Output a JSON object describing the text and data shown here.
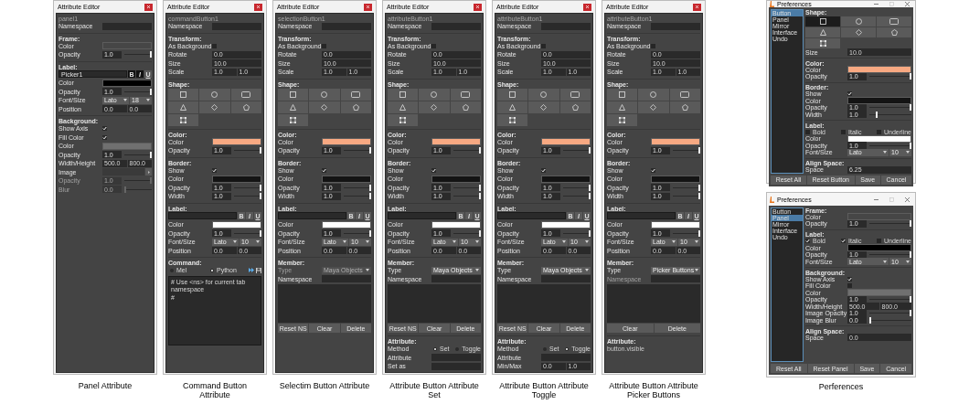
{
  "editors": [
    {
      "title": "Attribute Editor",
      "object": "panel1",
      "caption": "Panel Attribute",
      "sections": [
        {
          "rows": [
            {
              "kind": "field",
              "label": "Namespace"
            }
          ]
        },
        {
          "header": "Frame:",
          "rows": [
            {
              "kind": "color",
              "label": "Color",
              "color": "#464646"
            },
            {
              "kind": "slider",
              "label": "Opacity",
              "value": "1.0",
              "level": 1
            }
          ]
        },
        {
          "header": "Label:",
          "rows": [
            {
              "kind": "label_input",
              "value": "Picker1",
              "buttons": [
                {
                  "label": "B",
                  "selected": true
                },
                {
                  "label": "I",
                  "selected": true
                },
                {
                  "label": "U",
                  "selected": false
                }
              ]
            },
            {
              "kind": "color",
              "label": "Color",
              "color": "#000000"
            },
            {
              "kind": "slider",
              "label": "Opacity",
              "value": "1.0",
              "level": 1
            },
            {
              "kind": "font",
              "label": "Font/Size",
              "font": "Lato",
              "size": "18"
            },
            {
              "kind": "field",
              "label": "Position",
              "values": [
                "0.0",
                "0.0"
              ]
            }
          ]
        },
        {
          "header": "Background:",
          "rows": [
            {
              "kind": "check",
              "label": "Show Axis",
              "checked": true
            },
            {
              "kind": "check",
              "label": "Fill Color",
              "checked": true
            },
            {
              "kind": "color",
              "label": "Color",
              "color": "#707070"
            },
            {
              "kind": "slider",
              "label": "Opacity",
              "value": "1.0",
              "level": 1,
              "disabled": false
            },
            {
              "kind": "field",
              "label": "Width/Height",
              "values": [
                "500.0",
                "800.0"
              ]
            },
            {
              "kind": "image",
              "label": "Image"
            },
            {
              "kind": "slider",
              "label": "Opacity",
              "value": "1.0",
              "level": 1,
              "disabled": true
            },
            {
              "kind": "slider",
              "label": "Blur",
              "value": "0.0",
              "level": 0,
              "disabled": true
            }
          ]
        }
      ]
    },
    {
      "title": "Attribute Editor",
      "object": "commandButton1",
      "caption": "Command Button Attribute",
      "sections": [
        {
          "rows": [
            {
              "kind": "field",
              "label": "Namespace"
            }
          ]
        },
        {
          "header": "Transform:",
          "rows": [
            {
              "kind": "check",
              "label": "As Background",
              "checked": false
            },
            {
              "kind": "field",
              "label": "Rotate",
              "values": [
                "0.0"
              ]
            },
            {
              "kind": "field",
              "label": "Size",
              "values": [
                "10.0"
              ]
            },
            {
              "kind": "field",
              "label": "Scale",
              "values": [
                "1.0",
                "1.0"
              ]
            }
          ]
        },
        {
          "header": "Shape:",
          "rows": [
            {
              "kind": "shapes",
              "shapes": [
                {
                  "kind": "square",
                  "selected": false
                },
                {
                  "kind": "circle",
                  "selected": false
                },
                {
                  "kind": "rounded_rectangle",
                  "selected": false
                },
                {
                  "kind": "triangle",
                  "selected": false
                },
                {
                  "kind": "diamond",
                  "selected": false
                },
                {
                  "kind": "pentagon",
                  "selected": false
                },
                {
                  "kind": "frame",
                  "selected": false
                }
              ]
            }
          ]
        },
        {
          "header": "Color:",
          "rows": [
            {
              "kind": "color",
              "label": "Color",
              "color": "#f8a982"
            },
            {
              "kind": "slider",
              "label": "Opacity",
              "value": "1.0",
              "level": 1
            }
          ]
        },
        {
          "header": "Border:",
          "rows": [
            {
              "kind": "check",
              "label": "Show",
              "checked": true
            },
            {
              "kind": "color",
              "label": "Color",
              "color": "#141414"
            },
            {
              "kind": "slider",
              "label": "Opacity",
              "value": "1.0",
              "level": 1
            },
            {
              "kind": "slider",
              "label": "Width",
              "value": "1.0",
              "level": 1
            }
          ]
        },
        {
          "header": "Label:",
          "rows": [
            {
              "kind": "label_input",
              "buttons": [
                {
                  "label": "B",
                  "selected": false
                },
                {
                  "label": "I",
                  "selected": false
                },
                {
                  "label": "U",
                  "selected": false
                }
              ]
            },
            {
              "kind": "color",
              "label": "Color",
              "color": "#ffffff"
            },
            {
              "kind": "slider",
              "label": "Opacity",
              "value": "1.0",
              "level": 1
            },
            {
              "kind": "font",
              "label": "Font/Size",
              "font": "Lato",
              "size": "10"
            },
            {
              "kind": "field",
              "label": "Position",
              "values": [
                "0.0",
                "0.0"
              ]
            }
          ]
        },
        {
          "header": "Command:",
          "rows": [
            {
              "kind": "lang",
              "options": [
                {
                  "label": "Mel",
                  "selected": false
                },
                {
                  "label": "Python",
                  "selected": true
                }
              ]
            },
            {
              "kind": "textarea",
              "lines": [
                "# Use <ns> for current tab namespace",
                "#"
              ]
            }
          ]
        }
      ]
    },
    {
      "title": "Attribute Editor",
      "object": "selectionButton1",
      "caption": "Selectim Button Attribute",
      "sections": [
        {
          "rows": [
            {
              "kind": "field",
              "label": "Namespace"
            }
          ]
        },
        {
          "header": "Transform:",
          "rows": [
            {
              "kind": "check",
              "label": "As Background",
              "checked": false
            },
            {
              "kind": "field",
              "label": "Rotate",
              "values": [
                "0.0"
              ]
            },
            {
              "kind": "field",
              "label": "Size",
              "values": [
                "10.0"
              ]
            },
            {
              "kind": "field",
              "label": "Scale",
              "values": [
                "1.0",
                "1.0"
              ]
            }
          ]
        },
        {
          "header": "Shape:",
          "rows": [
            {
              "kind": "shapes",
              "shapes": [
                {
                  "kind": "square",
                  "selected": false
                },
                {
                  "kind": "circle",
                  "selected": false
                },
                {
                  "kind": "rounded_rectangle",
                  "selected": false
                },
                {
                  "kind": "triangle",
                  "selected": false
                },
                {
                  "kind": "diamond",
                  "selected": false
                },
                {
                  "kind": "pentagon",
                  "selected": false
                },
                {
                  "kind": "frame",
                  "selected": false
                }
              ]
            }
          ]
        },
        {
          "header": "Color:",
          "rows": [
            {
              "kind": "color",
              "label": "Color",
              "color": "#f8a982"
            },
            {
              "kind": "slider",
              "label": "Opacity",
              "value": "1.0",
              "level": 1
            }
          ]
        },
        {
          "header": "Border:",
          "rows": [
            {
              "kind": "check",
              "label": "Show",
              "checked": true
            },
            {
              "kind": "color",
              "label": "Color",
              "color": "#141414"
            },
            {
              "kind": "slider",
              "label": "Opacity",
              "value": "1.0",
              "level": 1
            },
            {
              "kind": "slider",
              "label": "Width",
              "value": "1.0",
              "level": 1
            }
          ]
        },
        {
          "header": "Label:",
          "rows": [
            {
              "kind": "label_input",
              "buttons": [
                {
                  "label": "B",
                  "selected": false
                },
                {
                  "label": "I",
                  "selected": false
                },
                {
                  "label": "U",
                  "selected": false
                }
              ]
            },
            {
              "kind": "color",
              "label": "Color",
              "color": "#ffffff"
            },
            {
              "kind": "slider",
              "label": "Opacity",
              "value": "1.0",
              "level": 1
            },
            {
              "kind": "font",
              "label": "Font/Size",
              "font": "Lato",
              "size": "10"
            },
            {
              "kind": "field",
              "label": "Position",
              "values": [
                "0.0",
                "0.0"
              ]
            }
          ]
        },
        {
          "header": "Member:",
          "rows": [
            {
              "kind": "combo",
              "label": "Type",
              "value": "Maya Objects",
              "disabled": true
            },
            {
              "kind": "field",
              "label": "Namespace",
              "disabled": false
            },
            {
              "kind": "list"
            },
            {
              "kind": "buttons",
              "buttons": [
                "Reset NS",
                "Clear",
                "Delete"
              ]
            }
          ]
        }
      ]
    },
    {
      "title": "Attribute Editor",
      "object": "attributeButton1",
      "caption": "Attribute Button Attribute Set",
      "sections": [
        {
          "rows": [
            {
              "kind": "field",
              "label": "Namespace"
            }
          ]
        },
        {
          "header": "Transform:",
          "rows": [
            {
              "kind": "check",
              "label": "As Background",
              "checked": false
            },
            {
              "kind": "field",
              "label": "Rotate",
              "values": [
                "0.0"
              ]
            },
            {
              "kind": "field",
              "label": "Size",
              "values": [
                "10.0"
              ]
            },
            {
              "kind": "field",
              "label": "Scale",
              "values": [
                "1.0",
                "1.0"
              ]
            }
          ]
        },
        {
          "header": "Shape:",
          "rows": [
            {
              "kind": "shapes",
              "shapes": [
                {
                  "kind": "square",
                  "selected": false
                },
                {
                  "kind": "circle",
                  "selected": false
                },
                {
                  "kind": "rounded_rectangle",
                  "selected": false
                },
                {
                  "kind": "triangle",
                  "selected": false
                },
                {
                  "kind": "diamond",
                  "selected": false
                },
                {
                  "kind": "pentagon",
                  "selected": false
                },
                {
                  "kind": "frame",
                  "selected": false
                }
              ]
            }
          ]
        },
        {
          "header": "Color:",
          "rows": [
            {
              "kind": "color",
              "label": "Color",
              "color": "#f8a982"
            },
            {
              "kind": "slider",
              "label": "Opacity",
              "value": "1.0",
              "level": 1
            }
          ]
        },
        {
          "header": "Border:",
          "rows": [
            {
              "kind": "check",
              "label": "Show",
              "checked": true
            },
            {
              "kind": "color",
              "label": "Color",
              "color": "#141414"
            },
            {
              "kind": "slider",
              "label": "Opacity",
              "value": "1.0",
              "level": 1
            },
            {
              "kind": "slider",
              "label": "Width",
              "value": "1.0",
              "level": 1
            }
          ]
        },
        {
          "header": "Label:",
          "rows": [
            {
              "kind": "label_input",
              "buttons": [
                {
                  "label": "B",
                  "selected": false
                },
                {
                  "label": "I",
                  "selected": false
                },
                {
                  "label": "U",
                  "selected": false
                }
              ]
            },
            {
              "kind": "color",
              "label": "Color",
              "color": "#ffffff"
            },
            {
              "kind": "slider",
              "label": "Opacity",
              "value": "1.0",
              "level": 1
            },
            {
              "kind": "font",
              "label": "Font/Size",
              "font": "Lato",
              "size": "10"
            },
            {
              "kind": "field",
              "label": "Position",
              "values": [
                "0.0",
                "0.0"
              ]
            }
          ]
        },
        {
          "header": "Member:",
          "rows": [
            {
              "kind": "combo",
              "label": "Type",
              "value": "Maya Objects",
              "disabled": false
            },
            {
              "kind": "field",
              "label": "Namespace",
              "disabled": false
            },
            {
              "kind": "list"
            },
            {
              "kind": "buttons",
              "buttons": [
                "Reset NS",
                "Clear",
                "Delete"
              ]
            }
          ]
        },
        {
          "header": "Attribute:",
          "rows": [
            {
              "kind": "radio",
              "label": "Method",
              "options": [
                {
                  "label": "Set",
                  "selected": true
                },
                {
                  "label": "Toggle",
                  "selected": false
                }
              ]
            },
            {
              "kind": "field",
              "label": "Attribute"
            },
            {
              "kind": "field",
              "label": "Set as"
            }
          ]
        }
      ]
    },
    {
      "title": "Attribute Editor",
      "object": "attributeButton1",
      "caption": "Attribute Button Attribute Toggle",
      "sections": [
        {
          "rows": [
            {
              "kind": "field",
              "label": "Namespace"
            }
          ]
        },
        {
          "header": "Transform:",
          "rows": [
            {
              "kind": "check",
              "label": "As Background",
              "checked": false
            },
            {
              "kind": "field",
              "label": "Rotate",
              "values": [
                "0.0"
              ]
            },
            {
              "kind": "field",
              "label": "Size",
              "values": [
                "10.0"
              ]
            },
            {
              "kind": "field",
              "label": "Scale",
              "values": [
                "1.0",
                "1.0"
              ]
            }
          ]
        },
        {
          "header": "Shape:",
          "rows": [
            {
              "kind": "shapes",
              "shapes": [
                {
                  "kind": "square",
                  "selected": false
                },
                {
                  "kind": "circle",
                  "selected": false
                },
                {
                  "kind": "rounded_rectangle",
                  "selected": false
                },
                {
                  "kind": "triangle",
                  "selected": false
                },
                {
                  "kind": "diamond",
                  "selected": false
                },
                {
                  "kind": "pentagon",
                  "selected": false
                },
                {
                  "kind": "frame",
                  "selected": false
                }
              ]
            }
          ]
        },
        {
          "header": "Color:",
          "rows": [
            {
              "kind": "color",
              "label": "Color",
              "color": "#f8a982"
            },
            {
              "kind": "slider",
              "label": "Opacity",
              "value": "1.0",
              "level": 1
            }
          ]
        },
        {
          "header": "Border:",
          "rows": [
            {
              "kind": "check",
              "label": "Show",
              "checked": true
            },
            {
              "kind": "color",
              "label": "Color",
              "color": "#141414"
            },
            {
              "kind": "slider",
              "label": "Opacity",
              "value": "1.0",
              "level": 1
            },
            {
              "kind": "slider",
              "label": "Width",
              "value": "1.0",
              "level": 1
            }
          ]
        },
        {
          "header": "Label:",
          "rows": [
            {
              "kind": "label_input",
              "buttons": [
                {
                  "label": "B",
                  "selected": false
                },
                {
                  "label": "I",
                  "selected": false
                },
                {
                  "label": "U",
                  "selected": false
                }
              ]
            },
            {
              "kind": "color",
              "label": "Color",
              "color": "#ffffff"
            },
            {
              "kind": "slider",
              "label": "Opacity",
              "value": "1.0",
              "level": 1
            },
            {
              "kind": "font",
              "label": "Font/Size",
              "font": "Lato",
              "size": "10"
            },
            {
              "kind": "field",
              "label": "Position",
              "values": [
                "0.0",
                "0.0"
              ]
            }
          ]
        },
        {
          "header": "Member:",
          "rows": [
            {
              "kind": "combo",
              "label": "Type",
              "value": "Maya Objects",
              "disabled": false
            },
            {
              "kind": "field",
              "label": "Namespace",
              "disabled": false
            },
            {
              "kind": "list"
            },
            {
              "kind": "buttons",
              "buttons": [
                "Reset NS",
                "Clear",
                "Delete"
              ]
            }
          ]
        },
        {
          "header": "Attribute:",
          "rows": [
            {
              "kind": "radio",
              "label": "Method",
              "options": [
                {
                  "label": "Set",
                  "selected": false
                },
                {
                  "label": "Toggle",
                  "selected": true
                }
              ]
            },
            {
              "kind": "field",
              "label": "Attribute"
            },
            {
              "kind": "field",
              "label": "Min/Max",
              "values": [
                "0.0",
                "1.0"
              ]
            }
          ]
        }
      ]
    },
    {
      "title": "Attribute Editor",
      "object": "attributeButton1",
      "caption": "Attribute Button Attribute Picker Buttons",
      "sections": [
        {
          "rows": [
            {
              "kind": "field",
              "label": "Namespace"
            }
          ]
        },
        {
          "header": "Transform:",
          "rows": [
            {
              "kind": "check",
              "label": "As Background",
              "checked": false
            },
            {
              "kind": "field",
              "label": "Rotate",
              "values": [
                "0.0"
              ]
            },
            {
              "kind": "field",
              "label": "Size",
              "values": [
                "10.0"
              ]
            },
            {
              "kind": "field",
              "label": "Scale",
              "values": [
                "1.0",
                "1.0"
              ]
            }
          ]
        },
        {
          "header": "Shape:",
          "rows": [
            {
              "kind": "shapes",
              "shapes": [
                {
                  "kind": "square",
                  "selected": false
                },
                {
                  "kind": "circle",
                  "selected": false
                },
                {
                  "kind": "rounded_rectangle",
                  "selected": false
                },
                {
                  "kind": "triangle",
                  "selected": false
                },
                {
                  "kind": "diamond",
                  "selected": false
                },
                {
                  "kind": "pentagon",
                  "selected": false
                },
                {
                  "kind": "frame",
                  "selected": false
                }
              ]
            }
          ]
        },
        {
          "header": "Color:",
          "rows": [
            {
              "kind": "color",
              "label": "Color",
              "color": "#f8a982"
            },
            {
              "kind": "slider",
              "label": "Opacity",
              "value": "1.0",
              "level": 1
            }
          ]
        },
        {
          "header": "Border:",
          "rows": [
            {
              "kind": "check",
              "label": "Show",
              "checked": true
            },
            {
              "kind": "color",
              "label": "Color",
              "color": "#141414"
            },
            {
              "kind": "slider",
              "label": "Opacity",
              "value": "1.0",
              "level": 1
            },
            {
              "kind": "slider",
              "label": "Width",
              "value": "1.0",
              "level": 1
            }
          ]
        },
        {
          "header": "Label:",
          "rows": [
            {
              "kind": "label_input",
              "buttons": [
                {
                  "label": "B",
                  "selected": false
                },
                {
                  "label": "I",
                  "selected": false
                },
                {
                  "label": "U",
                  "selected": false
                }
              ]
            },
            {
              "kind": "color",
              "label": "Color",
              "color": "#ffffff"
            },
            {
              "kind": "slider",
              "label": "Opacity",
              "value": "1.0",
              "level": 1
            },
            {
              "kind": "font",
              "label": "Font/Size",
              "font": "Lato",
              "size": "10"
            },
            {
              "kind": "field",
              "label": "Position",
              "values": [
                "0.0",
                "0.0"
              ]
            }
          ]
        },
        {
          "header": "Member:",
          "rows": [
            {
              "kind": "combo",
              "label": "Type",
              "value": "Picker Buttons",
              "disabled": false
            },
            {
              "kind": "field",
              "label": "Namespace",
              "disabled": true
            },
            {
              "kind": "list"
            },
            {
              "kind": "buttons",
              "buttons": [
                "Clear",
                "Delete"
              ]
            }
          ]
        },
        {
          "header": "Attribute:",
          "rows": [
            {
              "kind": "text",
              "text": "button.visible"
            }
          ]
        }
      ]
    }
  ],
  "preferences": [
    {
      "title": "Preferences",
      "nav": [
        {
          "label": "Button",
          "selected": true
        },
        {
          "label": "Panel",
          "selected": false
        },
        {
          "label": "Mirror",
          "selected": false
        },
        {
          "label": "Interface",
          "selected": false
        },
        {
          "label": "Undo",
          "selected": false
        }
      ],
      "sections": [
        {
          "header": "Shape:",
          "rows": [
            {
              "kind": "shapes",
              "shapes": [
                {
                  "kind": "square",
                  "selected": true
                },
                {
                  "kind": "circle",
                  "selected": false
                },
                {
                  "kind": "rounded_rectangle",
                  "selected": false
                },
                {
                  "kind": "triangle",
                  "selected": false
                },
                {
                  "kind": "diamond",
                  "selected": false
                },
                {
                  "kind": "pentagon",
                  "selected": false
                },
                {
                  "kind": "frame",
                  "selected": false
                }
              ]
            },
            {
              "kind": "field",
              "label": "Size",
              "values": [
                "10.0"
              ]
            }
          ]
        },
        {
          "header": "Color:",
          "rows": [
            {
              "kind": "color",
              "label": "Color",
              "color": "#f8a982"
            },
            {
              "kind": "slider",
              "label": "Opacity",
              "value": "1.0",
              "level": 1
            }
          ]
        },
        {
          "header": "Border:",
          "rows": [
            {
              "kind": "check",
              "label": "Show",
              "checked": true
            },
            {
              "kind": "color",
              "label": "Color",
              "color": "#141414"
            },
            {
              "kind": "slider",
              "label": "Opacity",
              "value": "1.0",
              "level": 1
            },
            {
              "kind": "slider",
              "label": "Width",
              "value": "1.0",
              "level": 0.15
            }
          ]
        },
        {
          "header": "Label:",
          "rows": [
            {
              "kind": "styles",
              "options": [
                {
                  "label": "Bold",
                  "checked": false
                },
                {
                  "label": "Italic",
                  "checked": false
                },
                {
                  "label": "Underline",
                  "checked": false
                }
              ]
            },
            {
              "kind": "color",
              "label": "Color",
              "color": "#ffffff"
            },
            {
              "kind": "slider",
              "label": "Opacity",
              "value": "1.0",
              "level": 1
            },
            {
              "kind": "font",
              "label": "Font/Size",
              "font": "Lato",
              "size": "10"
            }
          ]
        },
        {
          "header": "Align Space:",
          "rows": [
            {
              "kind": "field",
              "label": "Space",
              "values": [
                "6.25"
              ]
            }
          ]
        }
      ],
      "buttons": [
        "Reset All",
        "Reset Button",
        "Save",
        "Cancel"
      ]
    },
    {
      "title": "Preferences",
      "nav": [
        {
          "label": "Button",
          "selected": false
        },
        {
          "label": "Panel",
          "selected": true
        },
        {
          "label": "Mirror",
          "selected": false
        },
        {
          "label": "Interface",
          "selected": false
        },
        {
          "label": "Undo",
          "selected": false
        }
      ],
      "sections": [
        {
          "header": "Frame:",
          "rows": [
            {
              "kind": "color",
              "label": "Color",
              "color": "#464646"
            },
            {
              "kind": "slider",
              "label": "Opacity",
              "value": "1.0",
              "level": 1
            }
          ]
        },
        {
          "header": "Label:",
          "rows": [
            {
              "kind": "styles",
              "options": [
                {
                  "label": "Bold",
                  "checked": true
                },
                {
                  "label": "Italic",
                  "checked": true
                },
                {
                  "label": "Underline",
                  "checked": false
                }
              ]
            },
            {
              "kind": "color",
              "label": "Color",
              "color": "#000000"
            },
            {
              "kind": "slider",
              "label": "Opacity",
              "value": "1.0",
              "level": 1
            },
            {
              "kind": "font",
              "label": "Font/Size",
              "font": "Lato",
              "size": "10"
            }
          ]
        },
        {
          "header": "Background:",
          "rows": [
            {
              "kind": "check",
              "label": "Show Axis",
              "checked": true
            },
            {
              "kind": "check",
              "label": "Fill Color",
              "checked": false
            },
            {
              "kind": "color",
              "label": "Color",
              "color": "#707070"
            },
            {
              "kind": "slider",
              "label": "Opacity",
              "value": "1.0",
              "level": 1
            },
            {
              "kind": "field",
              "label": "Width/Height",
              "values": [
                "500.0",
                "800.0"
              ]
            },
            {
              "kind": "slider",
              "label": "Image Opacity",
              "value": "1.0",
              "level": 1
            },
            {
              "kind": "slider",
              "label": "Image Blur",
              "value": "0.0",
              "level": 0
            }
          ]
        },
        {
          "header": "Align Space:",
          "rows": [
            {
              "kind": "field",
              "label": "Space",
              "values": [
                "0.0"
              ]
            }
          ]
        }
      ],
      "buttons": [
        "Reset All",
        "Reset Panel",
        "Save",
        "Cancel"
      ]
    }
  ],
  "preferences_caption": "Perferences"
}
